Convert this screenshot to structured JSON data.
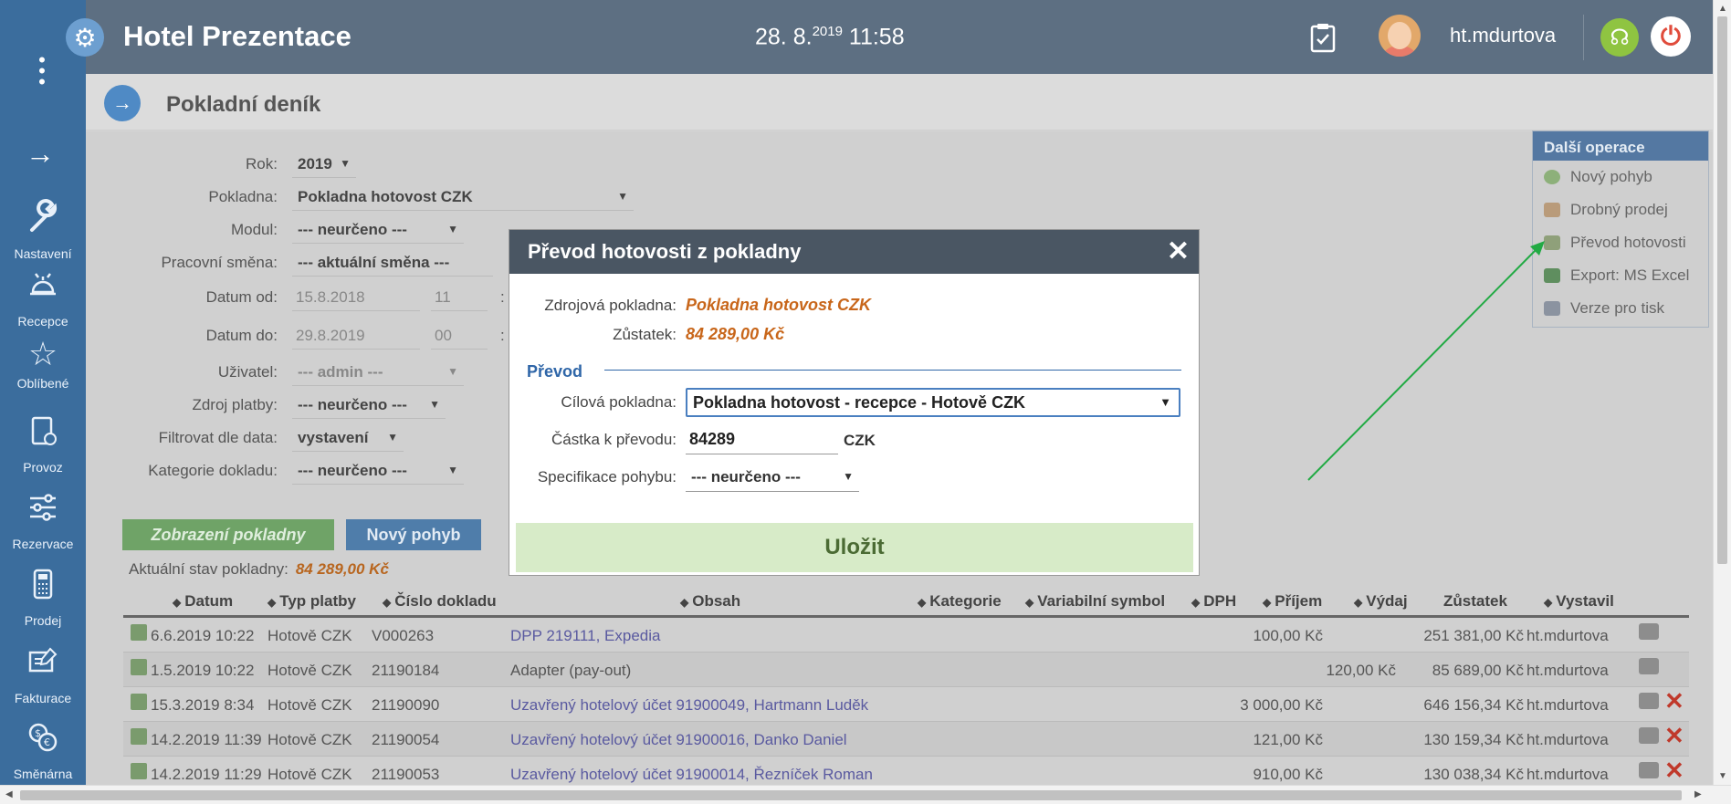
{
  "header": {
    "app_title": "Hotel Prezentace",
    "date": "28. 8.",
    "date_year": "2019",
    "time": "11:58",
    "username": "ht.mdurtova"
  },
  "sidebar": {
    "items": [
      {
        "label": "Nastavení",
        "icon": "wrench-icon"
      },
      {
        "label": "Recepce",
        "icon": "bell-icon"
      },
      {
        "label": "Oblíbené",
        "icon": "star-icon"
      },
      {
        "label": "Provoz",
        "icon": "clipboard-icon"
      },
      {
        "label": "Rezervace",
        "icon": "sliders-icon"
      },
      {
        "label": "Prodej",
        "icon": "calculator-icon"
      },
      {
        "label": "Fakturace",
        "icon": "invoice-icon"
      },
      {
        "label": "Směnárna",
        "icon": "exchange-icon"
      }
    ]
  },
  "page": {
    "title": "Pokladní deník"
  },
  "filters": {
    "rok_label": "Rok:",
    "rok": "2019",
    "pokladna_label": "Pokladna:",
    "pokladna": "Pokladna hotovost CZK",
    "modul_label": "Modul:",
    "modul": "--- neurčeno ---",
    "smena_label": "Pracovní směna:",
    "smena": "--- aktuální směna ---",
    "od_label": "Datum od:",
    "od_date": "15.8.2018",
    "od_hour": "11",
    "do_label": "Datum do:",
    "do_date": "29.8.2019",
    "do_hour": "00",
    "time_sep": ":",
    "uzivatel_label": "Uživatel:",
    "uzivatel": "--- admin ---",
    "zdroj_label": "Zdroj platby:",
    "zdroj": "--- neurčeno ---",
    "filtr_label": "Filtrovat dle data:",
    "filtr": "vystavení",
    "kategorie_label": "Kategorie dokladu:",
    "kategorie": "--- neurčeno ---"
  },
  "buttons": {
    "zobrazeni": "Zobrazení pokladny",
    "novy_pohyb": "Nový pohyb"
  },
  "state": {
    "label": "Aktuální stav pokladny:",
    "value": "84 289,00 Kč"
  },
  "table": {
    "columns": [
      "Datum",
      "Typ platby",
      "Číslo dokladu",
      "Obsah",
      "Kategorie",
      "Variabilní symbol",
      "DPH",
      "Příjem",
      "Výdaj",
      "Zůstatek",
      "Vystavil"
    ],
    "rows": [
      {
        "datum": "6.6.2019 10:22",
        "typ": "Hotově CZK",
        "cislo": "V000263",
        "obsah": "DPP 219111, Expedia",
        "prijem": "100,00 Kč",
        "vydaj": "",
        "zustatek": "251 381,00 Kč",
        "vystavil": "ht.mdurtova"
      },
      {
        "datum": "1.5.2019 10:22",
        "typ": "Hotově CZK",
        "cislo": "21190184",
        "obsah": "Adapter (pay-out)",
        "prijem": "",
        "vydaj": "120,00 Kč",
        "zustatek": "85 689,00 Kč",
        "vystavil": "ht.mdurtova"
      },
      {
        "datum": "15.3.2019 8:34",
        "typ": "Hotově CZK",
        "cislo": "21190090",
        "obsah": "Uzavřený hotelový účet 91900049, Hartmann Luděk",
        "prijem": "3 000,00 Kč",
        "vydaj": "",
        "zustatek": "646 156,34 Kč",
        "vystavil": "ht.mdurtova"
      },
      {
        "datum": "14.2.2019 11:39",
        "typ": "Hotově CZK",
        "cislo": "21190054",
        "obsah": "Uzavřený hotelový účet 91900016, Danko Daniel",
        "prijem": "121,00 Kč",
        "vydaj": "",
        "zustatek": "130 159,34 Kč",
        "vystavil": "ht.mdurtova"
      },
      {
        "datum": "14.2.2019 11:29",
        "typ": "Hotově CZK",
        "cislo": "21190053",
        "obsah": "Uzavřený hotelový účet 91900014, Řezníček Roman",
        "prijem": "910,00 Kč",
        "vydaj": "",
        "zustatek": "130 038,34 Kč",
        "vystavil": "ht.mdurtova"
      }
    ]
  },
  "side_panel": {
    "title": "Další operace",
    "items": [
      "Nový pohyb",
      "Drobný prodej",
      "Převod hotovosti",
      "Export: MS Excel",
      "Verze pro tisk"
    ]
  },
  "modal": {
    "title": "Převod hotovosti z pokladny",
    "close": "✕",
    "zdroj_label": "Zdrojová pokladna:",
    "zdroj_value": "Pokladna hotovost CZK",
    "zustatek_label": "Zůstatek:",
    "zustatek_value": "84 289,00 Kč",
    "section": "Převod",
    "cilova_label": "Cílová pokladna:",
    "cilova_value": "Pokladna hotovost - recepce - Hotově CZK",
    "castka_label": "Částka k převodu:",
    "castka_value": "84289",
    "currency": "CZK",
    "spec_label": "Specifikace pohybu:",
    "spec_value": "--- neurčeno ---",
    "save": "Uložit"
  },
  "colors": {
    "header": "#5d6f82",
    "sidebar": "#3b6d9d",
    "accent_orange": "#c8661a",
    "save_green": "#d7ebc8",
    "annotation_arrow": "#22aa44"
  }
}
